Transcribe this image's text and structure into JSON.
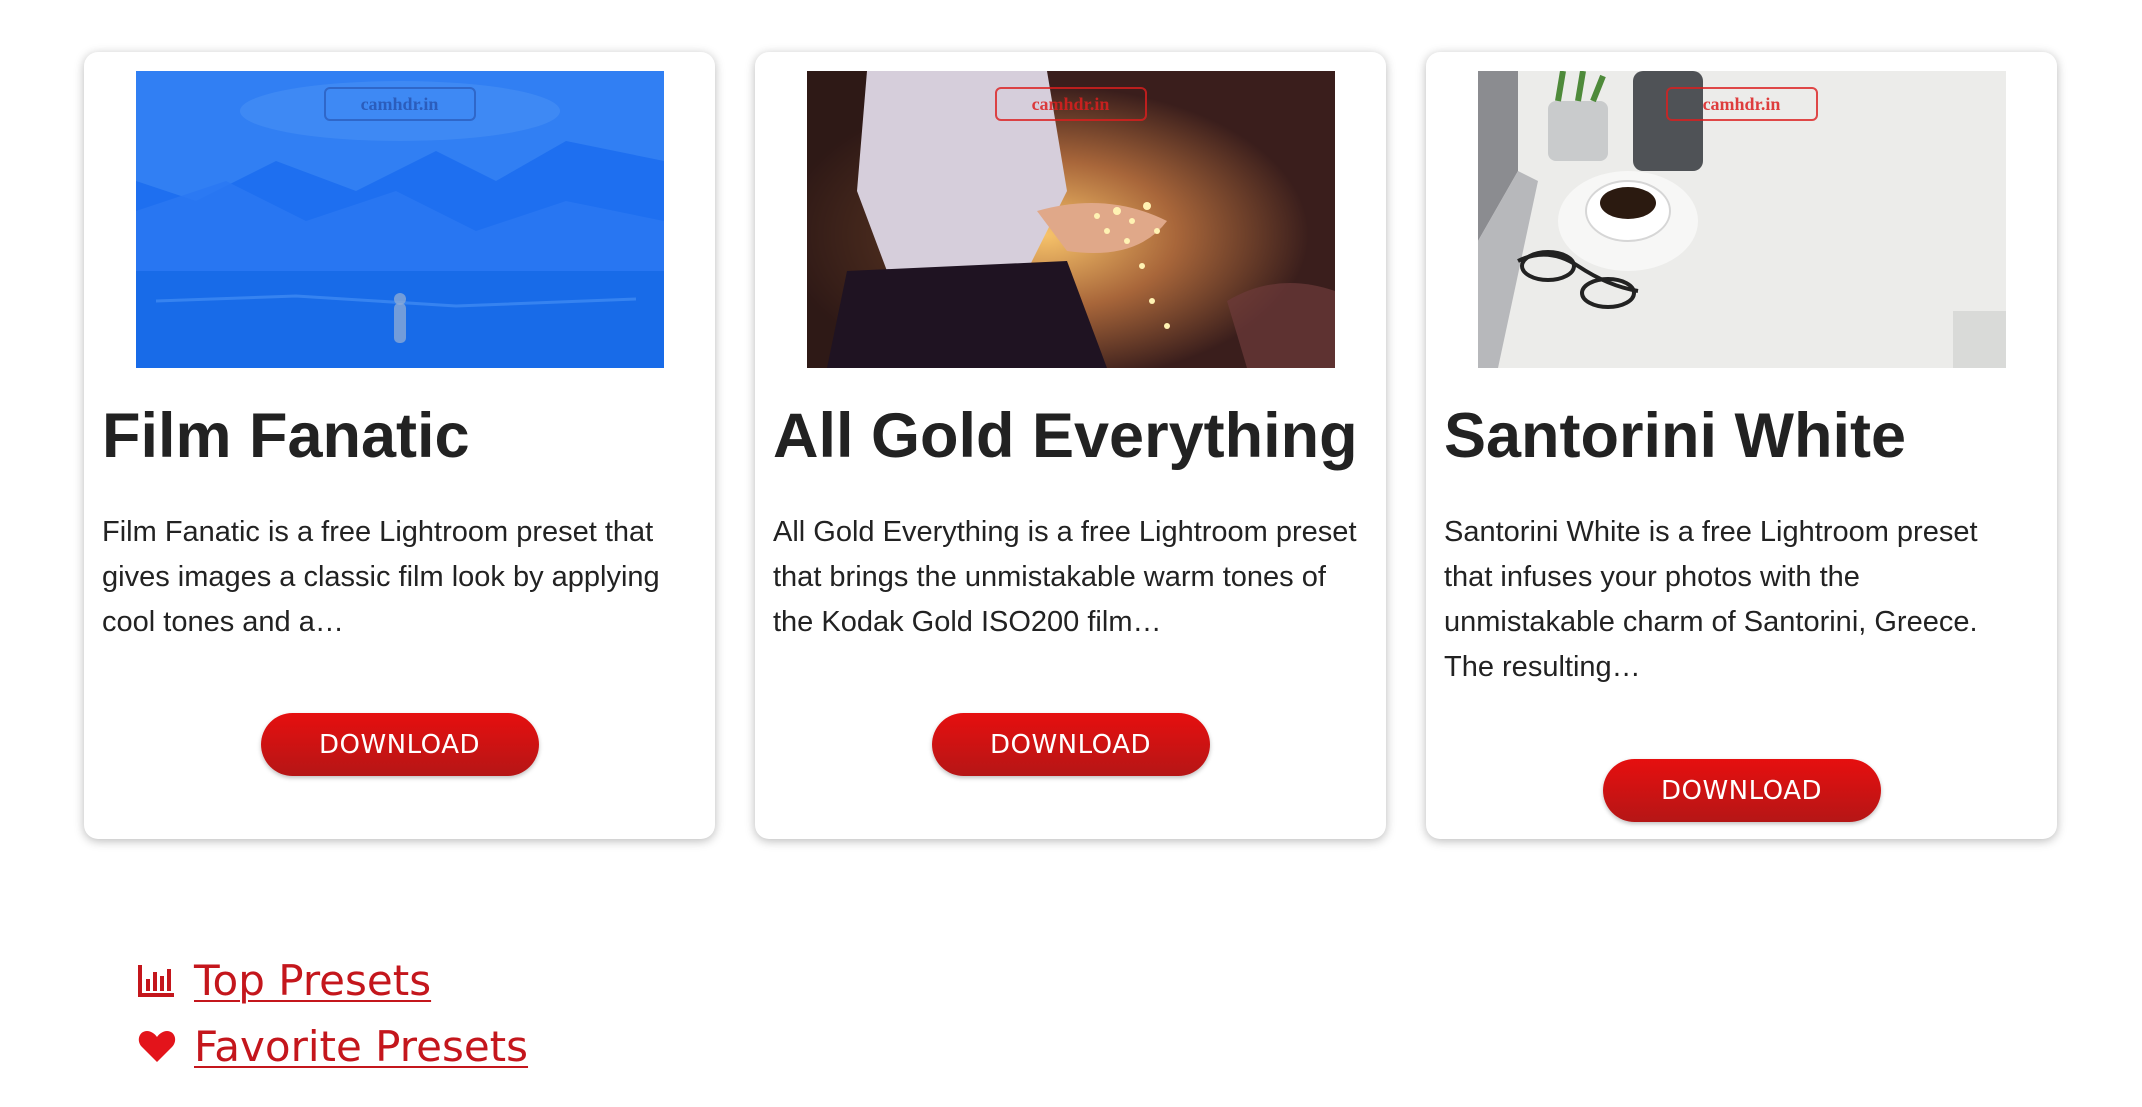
{
  "cards": [
    {
      "title": "Film Fanatic",
      "description": "Film Fanatic is a free Lightroom preset that gives images a classic film look by applying cool tones and a…",
      "button": "DOWNLOAD",
      "watermark": "camhdr.in",
      "image": "blue-tinted glacier lake with a figure"
    },
    {
      "title": "All Gold Everything",
      "description": "All Gold Everything is a free Lightroom preset that brings the unmistakable warm tones of the Kodak Gold ISO200 film…",
      "button": "DOWNLOAD",
      "watermark": "camhdr.in",
      "image": "person holding fairy lights"
    },
    {
      "title": "Santorini White",
      "description": "Santorini White is a free Lightroom preset that infuses your photos with the unmistakable charm of Santorini, Greece. The resulting…",
      "button": "DOWNLOAD",
      "watermark": "camhdr.in",
      "image": "white desk with coffee cup, glasses and plant"
    }
  ],
  "links": {
    "top_presets": "Top Presets",
    "favorite_presets": "Favorite Presets"
  },
  "icons": {
    "top_presets": "bar-chart-icon",
    "favorite_presets": "heart-icon"
  },
  "colors": {
    "accent": "#c4161c",
    "button_top": "#e60f0f",
    "button_bottom": "#b51616",
    "text": "#222222"
  }
}
